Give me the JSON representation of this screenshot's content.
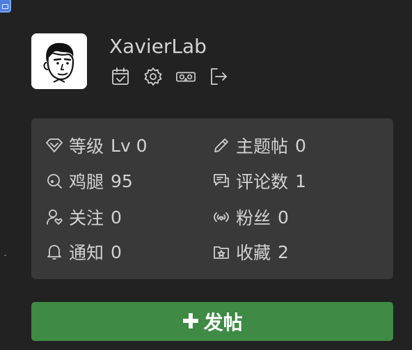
{
  "profile": {
    "username": "XavierLab"
  },
  "actions": [
    {
      "icon": "calendar-check-icon"
    },
    {
      "icon": "gear-icon"
    },
    {
      "icon": "vr-goggles-icon"
    },
    {
      "icon": "logout-icon"
    }
  ],
  "stats": {
    "level": {
      "label": "等级",
      "value": "Lv 0"
    },
    "topics": {
      "label": "主题帖",
      "value": "0"
    },
    "coins": {
      "label": "鸡腿",
      "value": "95"
    },
    "comments": {
      "label": "评论数",
      "value": "1"
    },
    "following": {
      "label": "关注",
      "value": "0"
    },
    "followers": {
      "label": "粉丝",
      "value": "0"
    },
    "notifications": {
      "label": "通知",
      "value": "0"
    },
    "favorites": {
      "label": "收藏",
      "value": "2"
    }
  },
  "post_button": {
    "icon": "plus-icon",
    "label": "发帖"
  },
  "colors": {
    "background": "#222222",
    "card": "#393939",
    "accent_green": "#3f8a44"
  }
}
